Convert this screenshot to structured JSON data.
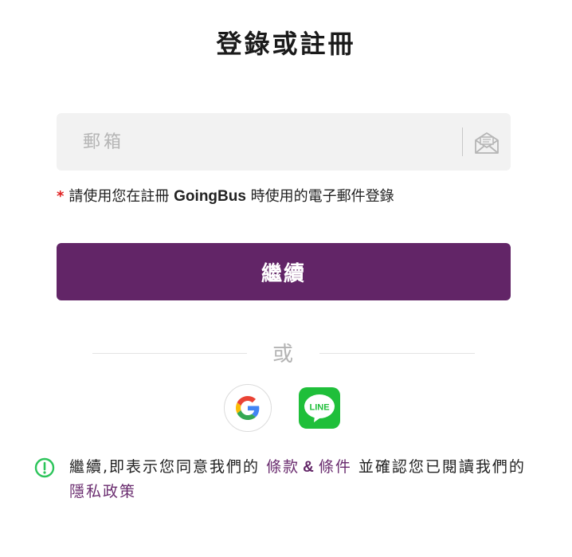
{
  "page": {
    "title": "登錄或註冊"
  },
  "email": {
    "placeholder": "郵箱",
    "value": ""
  },
  "hint": {
    "required_mark": "*",
    "before": "請使用您在註冊",
    "brand": "GoingBus",
    "after": "時使用的電子郵件登錄"
  },
  "continue_label": "繼續",
  "separator_label": "或",
  "social": {
    "google_label": "G",
    "line_label": "LINE"
  },
  "notice": {
    "prefix": "繼續,即表示您同意我們的",
    "terms_link": "條款",
    "amp": "&",
    "conditions_link": "條件",
    "middle": "並確認您已閱讀我們的",
    "privacy_link": "隱私政策"
  },
  "colors": {
    "primary": "#622567",
    "link": "#6a2c6f",
    "required": "#e02020",
    "notice_icon": "#2cc45a",
    "line_green": "#1fbf3a"
  },
  "icons": {
    "email_field": "envelope-open-icon",
    "notice": "exclamation-circle-icon"
  }
}
